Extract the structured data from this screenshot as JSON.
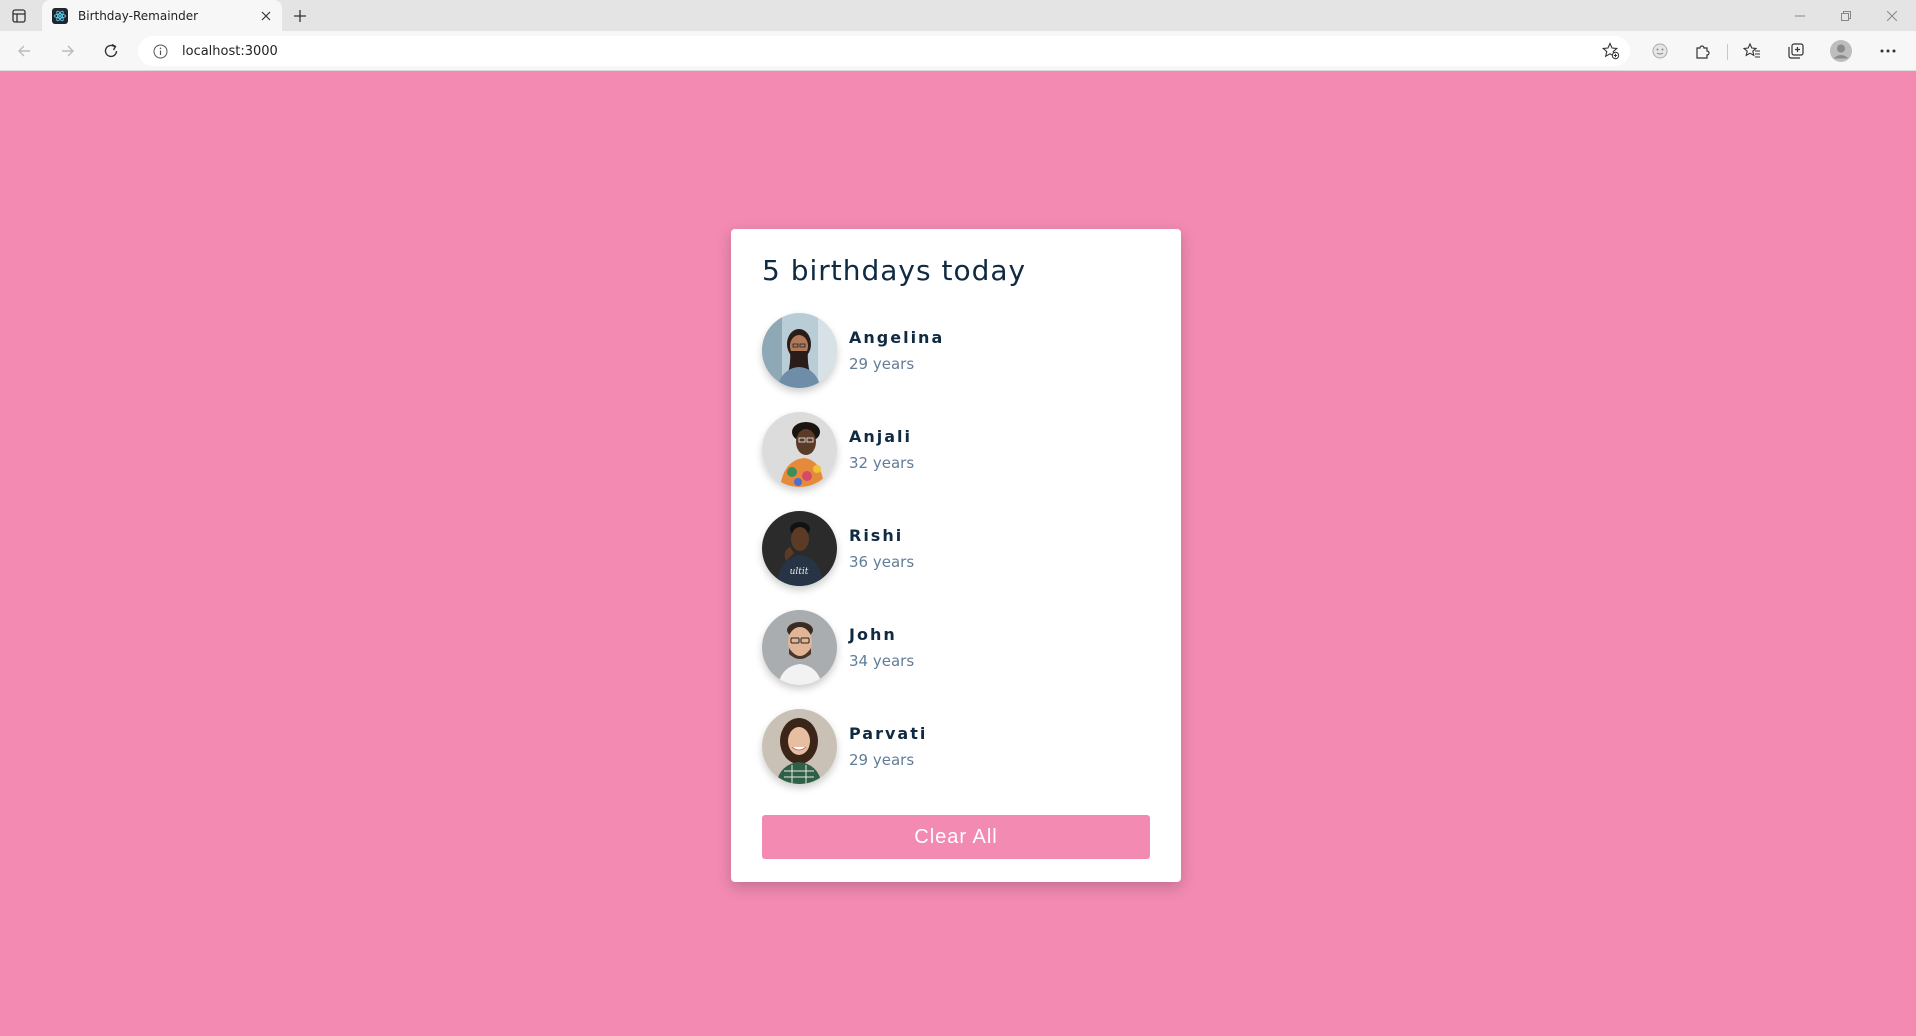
{
  "browser": {
    "tab_title": "Birthday-Remainder",
    "url": "localhost:3000"
  },
  "page": {
    "background": "#f28ab2",
    "title": "5 birthdays today",
    "people": [
      {
        "name": "Angelina",
        "age": "29 years"
      },
      {
        "name": "Anjali",
        "age": "32 years"
      },
      {
        "name": "Rishi",
        "age": "36 years"
      },
      {
        "name": "John",
        "age": "34 years"
      },
      {
        "name": "Parvati",
        "age": "29 years"
      }
    ],
    "clear_label": "Clear All"
  }
}
